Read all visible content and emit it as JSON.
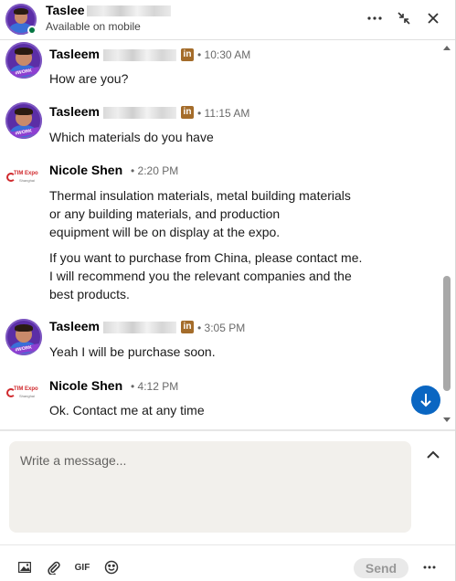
{
  "header": {
    "name_visible": "Taslee",
    "status": "Available on mobile"
  },
  "messages": [
    {
      "sender": "Tasleem",
      "time": "10:30 AM",
      "text": [
        "How are you?"
      ]
    },
    {
      "sender": "Tasleem",
      "time": "11:15 AM",
      "text": [
        "Which materials do you have"
      ]
    },
    {
      "sender": "Nicole Shen",
      "time": "2:20 PM",
      "text": [
        "Thermal insulation materials, metal building materials",
        "or any building materials, and production",
        "equipment will be on display at the expo.",
        "If you want to purchase from China, please contact me.",
        "I will recommend you the relevant companies and the",
        "best products."
      ]
    },
    {
      "sender": "Tasleem",
      "time": "3:05 PM",
      "text": [
        "Yeah I will be purchase soon."
      ]
    },
    {
      "sender": "Nicole Shen",
      "time": "4:12 PM",
      "text": [
        "Ok. Contact me at any time"
      ]
    }
  ],
  "time_separator": "•",
  "linkedin_badge": "in",
  "logo": {
    "main": "TIM Expo",
    "sub": "Shanghai"
  },
  "avatar_banner": "#WORK",
  "compose": {
    "placeholder": "Write a message...",
    "send_label": "Send",
    "gif_label": "GIF"
  },
  "colors": {
    "primary": "#0a66c2",
    "online": "#057642",
    "linkedin_premium": "#a46c2a",
    "compose_bg": "#f2f0ec"
  }
}
